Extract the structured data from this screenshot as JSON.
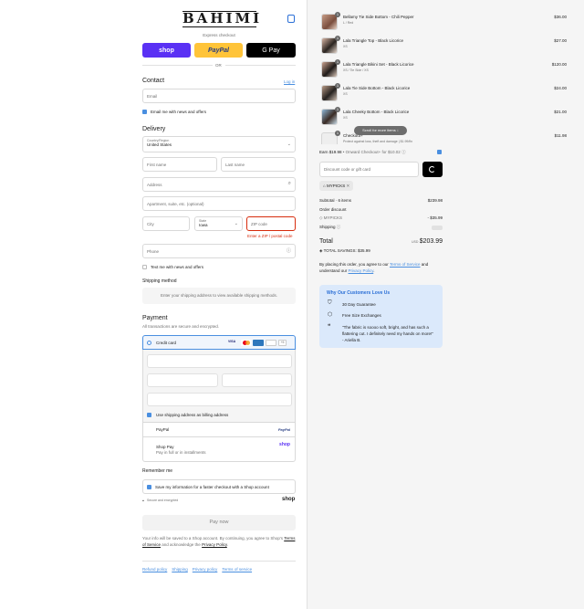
{
  "header": {
    "brand": "BAHIMI"
  },
  "express": {
    "label": "Express checkout",
    "shop": "shop",
    "paypal": "PayPal",
    "gpay": "G Pay",
    "or": "OR"
  },
  "contact": {
    "title": "Contact",
    "login": "Log in",
    "email_placeholder": "Email",
    "news": "Email me with news and offers"
  },
  "delivery": {
    "title": "Delivery",
    "country_label": "Country/Region",
    "country_value": "United States",
    "first_name": "First name",
    "last_name": "Last name",
    "address": "Address",
    "apartment": "Apartment, suite, etc. (optional)",
    "city": "City",
    "state_label": "State",
    "state_value": "Iowa",
    "zip": "ZIP code",
    "zip_error": "Enter a ZIP / postal code",
    "phone": "Phone",
    "text_news": "Text me with news and offers"
  },
  "shipping": {
    "title": "Shipping method",
    "note": "Enter your shipping address to view available shipping methods."
  },
  "payment": {
    "title": "Payment",
    "subtitle": "All transactions are secure and encrypted.",
    "credit_card": "Credit card",
    "card_brands": [
      "VISA",
      "MC",
      "AMEX",
      "DISC",
      "+5"
    ],
    "billing_same": "Use shipping address as billing address",
    "paypal": "PayPal",
    "paypal_logo": "PayPal",
    "shop_pay": "Shop Pay",
    "shop_pay_sub": "Pay in full or in installments",
    "shop_logo": "shop"
  },
  "remember": {
    "title": "Remember me",
    "save": "Save my information for a faster checkout with a Shop account",
    "secure": "Secure and encrypted",
    "shop_logo": "shop"
  },
  "paynow": {
    "label": "Pay now",
    "legal_1": "Your info will be saved to a Shop account. By continuing, you agree to Shop's",
    "terms": "Terms of Service",
    "legal_2": "and acknowledge the",
    "privacy": "Privacy Policy"
  },
  "footer": {
    "links": [
      "Refund policy",
      "Shipping",
      "Privacy policy",
      "Terms of service"
    ]
  },
  "cart": {
    "items": [
      {
        "qty": "1",
        "name": "Bellamy Tie Side Bottom - Chili Pepper",
        "variant": "L / Red",
        "price": "$36.00"
      },
      {
        "qty": "1",
        "name": "Lala Triangle Top - Black Licorice",
        "variant": "XS",
        "price": "$27.00"
      },
      {
        "qty": "1",
        "name": "Lala Triangle Bikini Set - Black Licorice",
        "variant": "XS / Tie Side / XS",
        "price": "$120.00"
      },
      {
        "qty": "1",
        "name": "Lala Tie Side Bottom - Black Licorice",
        "variant": "XS",
        "price": "$24.00"
      },
      {
        "qty": "1",
        "name": "Lala Cheeky Bottom - Black Licorice",
        "variant": "XS",
        "price": "$21.00"
      },
      {
        "qty": "1",
        "name": "Checkout+",
        "variant": "Protect against loss, theft and damage | $1.99/fin",
        "price": "$11.98"
      }
    ],
    "scroll_hint": "Scroll for more items",
    "earn": "Earn $19.98",
    "earn_rest": "• Onward Checkout+ for $10.02",
    "discount_placeholder": "Discount code or gift card",
    "code": "MYPICKS",
    "subtotal_label": "Subtotal · 6 items",
    "subtotal": "$239.98",
    "order_discount": "Order discount",
    "disc_code": "MYPICKS",
    "disc_amount": "- $35.99",
    "shipping_label": "Shipping",
    "total_label": "Total",
    "currency": "USD",
    "total": "$203.99",
    "savings": "TOTAL SAVINGS: $35.99",
    "agree_1": "By placing this order, you agree to our",
    "agree_terms": "Terms of Service",
    "agree_2": "and understand our",
    "agree_privacy": "Privacy Policy",
    "reviews_title": "Why Our Customers Love Us",
    "reviews": [
      "30 Day Guarantee",
      "Free Size Exchanges",
      "\"The fabric is soooo soft, bright, and has such a flattering cut. I definitely need my hands on more!\" - Ariella B."
    ]
  },
  "colors": {
    "shop": "#5a31f4",
    "paypal": "#ffc439",
    "accent": "#4a8fe0",
    "error": "#d72c0d"
  }
}
